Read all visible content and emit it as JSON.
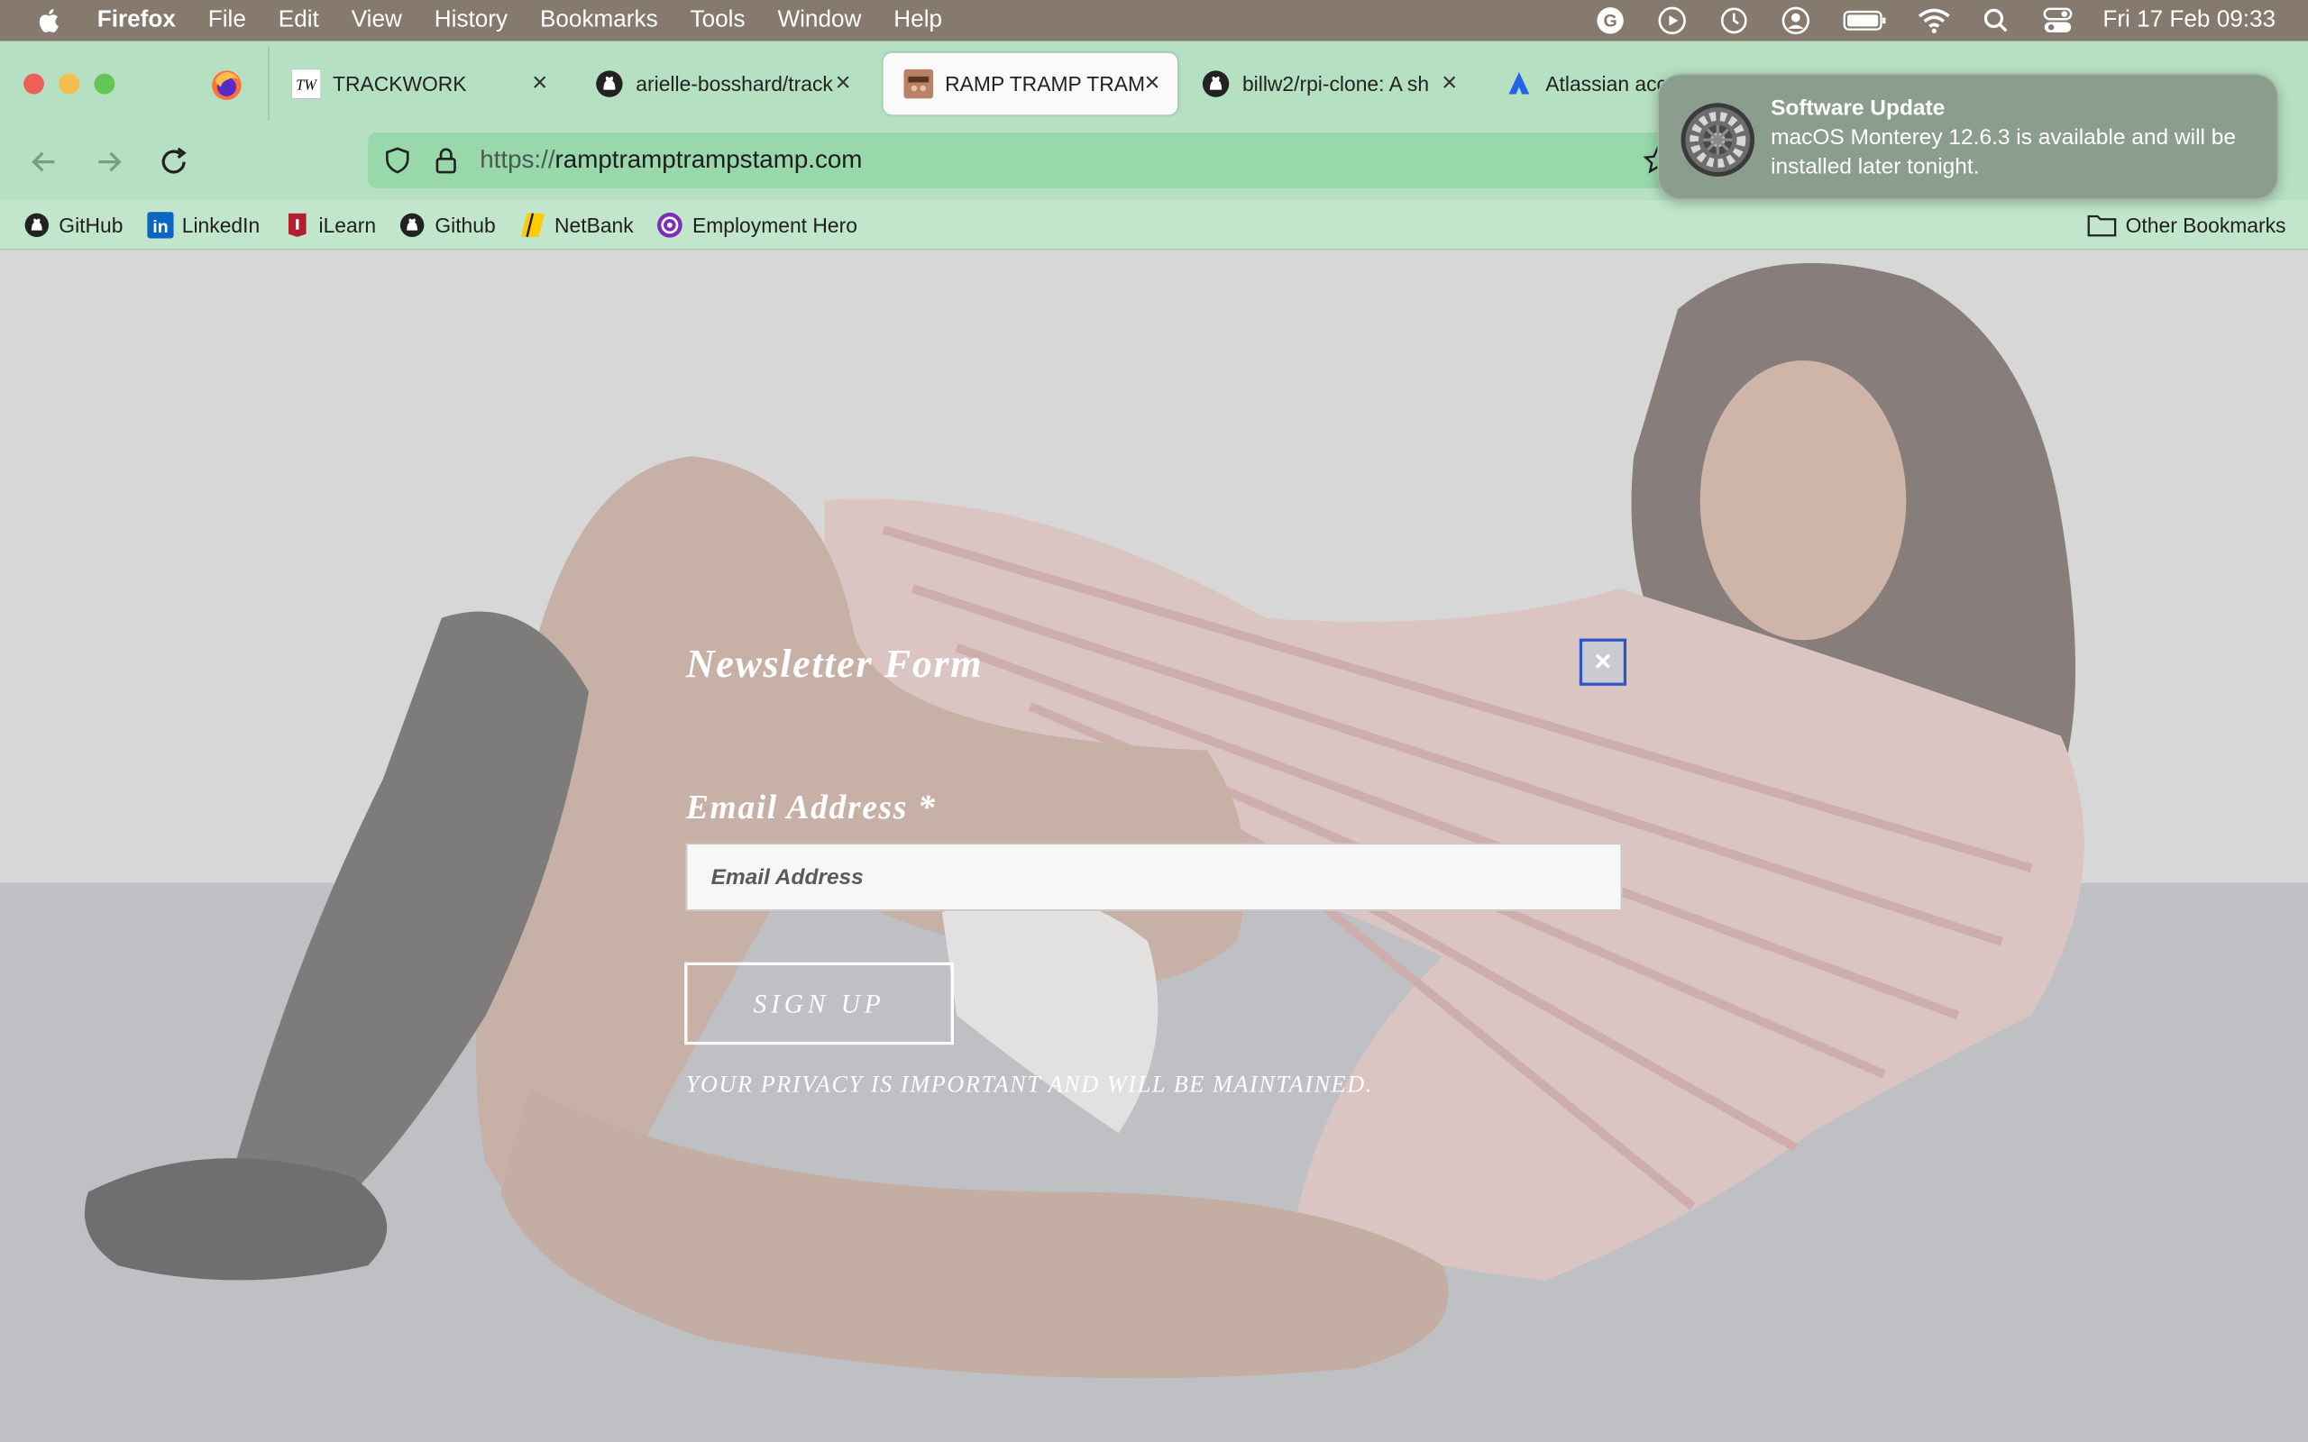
{
  "menubar": {
    "app": "Firefox",
    "items": [
      "File",
      "Edit",
      "View",
      "History",
      "Bookmarks",
      "Tools",
      "Window",
      "Help"
    ],
    "clock": "Fri 17 Feb  09:33"
  },
  "tabs": [
    {
      "title": "TRACKWORK",
      "icon": "trackwork-favicon"
    },
    {
      "title": "arielle-bosshard/track",
      "icon": "github-icon"
    },
    {
      "title": "RAMP TRAMP TRAMP",
      "icon": "ramp-favicon"
    },
    {
      "title": "billw2/rpi-clone: A sh",
      "icon": "github-icon"
    },
    {
      "title": "Atlassian acc",
      "icon": "atlassian-icon"
    }
  ],
  "urlbar": {
    "protocol": "https://",
    "host": "ramptramptrampstamp.com"
  },
  "bookmarks": [
    {
      "label": "GitHub",
      "icon": "github-icon"
    },
    {
      "label": "LinkedIn",
      "icon": "linkedin-icon"
    },
    {
      "label": "iLearn",
      "icon": "ilearn-icon"
    },
    {
      "label": "Github",
      "icon": "github-icon"
    },
    {
      "label": "NetBank",
      "icon": "netbank-icon"
    },
    {
      "label": "Employment Hero",
      "icon": "employment-hero-icon"
    }
  ],
  "other_bookmarks": "Other Bookmarks",
  "modal": {
    "title": "Newsletter Form",
    "close": "×",
    "email_label": "Email Address *",
    "email_placeholder": "Email Address",
    "email_value": "",
    "signup": "SIGN UP",
    "privacy": "YOUR PRIVACY IS IMPORTANT AND WILL BE MAINTAINED."
  },
  "notification": {
    "title": "Software Update",
    "body": "macOS Monterey 12.6.3 is available and will be installed later tonight."
  },
  "colors": {
    "chrome": "#b6e0c2",
    "urlbar": "#98d8ab",
    "close_border": "#2f55c8",
    "menubar": "#86796d"
  }
}
